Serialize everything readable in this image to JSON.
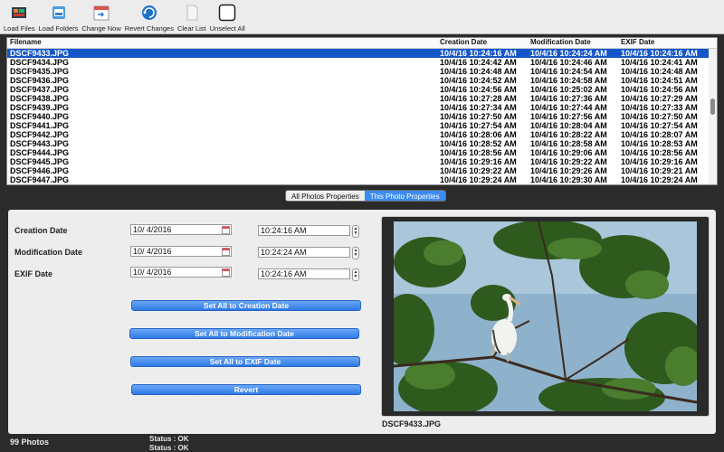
{
  "toolbar": {
    "buttons": [
      {
        "label": "Load Files",
        "icon": "load-files-icon"
      },
      {
        "label": "Load Folders",
        "icon": "load-folders-icon"
      },
      {
        "label": "Change Now",
        "icon": "change-now-icon"
      },
      {
        "label": "Revert Changes",
        "icon": "revert-changes-icon"
      },
      {
        "label": "Clear List",
        "icon": "clear-list-icon"
      },
      {
        "label": "Unselect All",
        "icon": "unselect-all-icon"
      }
    ]
  },
  "table": {
    "headers": [
      "Filename",
      "Creation Date",
      "Modification Date",
      "EXIF Date"
    ],
    "rows": [
      [
        "DSCF9433.JPG",
        "10/4/16 10:24:16 AM",
        "10/4/16 10:24:24 AM",
        "10/4/16 10:24:16 AM"
      ],
      [
        "DSCF9434.JPG",
        "10/4/16 10:24:42 AM",
        "10/4/16 10:24:46 AM",
        "10/4/16 10:24:41 AM"
      ],
      [
        "DSCF9435.JPG",
        "10/4/16 10:24:48 AM",
        "10/4/16 10:24:54 AM",
        "10/4/16 10:24:48 AM"
      ],
      [
        "DSCF9436.JPG",
        "10/4/16 10:24:52 AM",
        "10/4/16 10:24:58 AM",
        "10/4/16 10:24:51 AM"
      ],
      [
        "DSCF9437.JPG",
        "10/4/16 10:24:56 AM",
        "10/4/16 10:25:02 AM",
        "10/4/16 10:24:56 AM"
      ],
      [
        "DSCF9438.JPG",
        "10/4/16 10:27:28 AM",
        "10/4/16 10:27:36 AM",
        "10/4/16 10:27:29 AM"
      ],
      [
        "DSCF9439.JPG",
        "10/4/16 10:27:34 AM",
        "10/4/16 10:27:44 AM",
        "10/4/16 10:27:33 AM"
      ],
      [
        "DSCF9440.JPG",
        "10/4/16 10:27:50 AM",
        "10/4/16 10:27:56 AM",
        "10/4/16 10:27:50 AM"
      ],
      [
        "DSCF9441.JPG",
        "10/4/16 10:27:54 AM",
        "10/4/16 10:28:04 AM",
        "10/4/16 10:27:54 AM"
      ],
      [
        "DSCF9442.JPG",
        "10/4/16 10:28:06 AM",
        "10/4/16 10:28:22 AM",
        "10/4/16 10:28:07 AM"
      ],
      [
        "DSCF9443.JPG",
        "10/4/16 10:28:52 AM",
        "10/4/16 10:28:58 AM",
        "10/4/16 10:28:53 AM"
      ],
      [
        "DSCF9444.JPG",
        "10/4/16 10:28:56 AM",
        "10/4/16 10:29:06 AM",
        "10/4/16 10:28:56 AM"
      ],
      [
        "DSCF9445.JPG",
        "10/4/16 10:29:16 AM",
        "10/4/16 10:29:22 AM",
        "10/4/16 10:29:16 AM"
      ],
      [
        "DSCF9446.JPG",
        "10/4/16 10:29:22 AM",
        "10/4/16 10:29:26 AM",
        "10/4/16 10:29:21 AM"
      ],
      [
        "DSCF9447.JPG",
        "10/4/16 10:29:24 AM",
        "10/4/16 10:29:30 AM",
        "10/4/16 10:29:24 AM"
      ]
    ],
    "selected_index": 0
  },
  "tabs": {
    "all_photos": "All Photos Properties",
    "this_photo": "This Photo Properties"
  },
  "props": {
    "creation": {
      "label": "Creation Date",
      "date": "10/  4/2016",
      "time": "10:24:16 AM"
    },
    "modification": {
      "label": "Modification Date",
      "date": "10/  4/2016",
      "time": "10:24:24 AM"
    },
    "exif": {
      "label": "EXIF Date",
      "date": "10/  4/2016",
      "time": "10:24:16 AM"
    }
  },
  "actions": {
    "set_creation": "Set All to Creation Date",
    "set_modification": "Set All to Modification Date",
    "set_exif": "Set All to EXIF Date",
    "revert": "Revert"
  },
  "preview": {
    "filename": "DSCF9433.JPG"
  },
  "status": {
    "photo_count": "99 Photos",
    "line1": "Status : OK",
    "line2": "Status : OK"
  },
  "colors": {
    "selection": "#1557c8",
    "accent": "#3c8bf0",
    "button": "#2f7ae6"
  }
}
